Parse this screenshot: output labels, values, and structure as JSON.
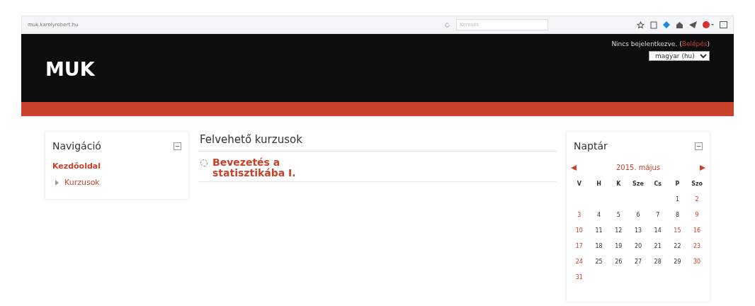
{
  "browser": {
    "url": "muk.karolyrobert.hu",
    "search": {
      "placeholder": "Keresés"
    }
  },
  "header": {
    "site_name": "MUK",
    "login_status": "Nincs bejelentkezve.",
    "login_open": "(",
    "login_link": "Belépés",
    "login_close": ")",
    "language": "magyar (hu)"
  },
  "navigation": {
    "title": "Navigáció",
    "items": [
      {
        "label": "Kezdőoldal",
        "kind": "link"
      },
      {
        "label": "Kurzusok",
        "kind": "branch"
      }
    ]
  },
  "courses": {
    "title": "Felvehető kurzusok",
    "items": [
      "Bevezetés a statisztikába I."
    ]
  },
  "calendar": {
    "title": "Naptár",
    "month": "2015. május",
    "weekdays": [
      "V",
      "H",
      "K",
      "Sze",
      "Cs",
      "P",
      "Szo"
    ],
    "weeks": [
      {
        "days": [
          {
            "kind": "blank"
          },
          {
            "kind": "blank"
          },
          {
            "kind": "blank"
          },
          {
            "kind": "blank"
          },
          {
            "kind": "blank"
          },
          {
            "kind": "day",
            "day": "1",
            "highlighted": false
          },
          {
            "kind": "day",
            "day": "2",
            "highlighted": true
          }
        ]
      },
      {
        "days": [
          {
            "kind": "day",
            "day": "3",
            "highlighted": true
          },
          {
            "kind": "day",
            "day": "4",
            "highlighted": false
          },
          {
            "kind": "day",
            "day": "5",
            "highlighted": false
          },
          {
            "kind": "day",
            "day": "6",
            "highlighted": false
          },
          {
            "kind": "day",
            "day": "7",
            "highlighted": false
          },
          {
            "kind": "day",
            "day": "8",
            "highlighted": false
          },
          {
            "kind": "day",
            "day": "9",
            "highlighted": true
          }
        ]
      },
      {
        "days": [
          {
            "kind": "day",
            "day": "10",
            "highlighted": true
          },
          {
            "kind": "day",
            "day": "11",
            "highlighted": false
          },
          {
            "kind": "day",
            "day": "12",
            "highlighted": false
          },
          {
            "kind": "day",
            "day": "13",
            "highlighted": false
          },
          {
            "kind": "day",
            "day": "14",
            "highlighted": false
          },
          {
            "kind": "day",
            "day": "15",
            "highlighted": true
          },
          {
            "kind": "day",
            "day": "16",
            "highlighted": true
          }
        ]
      },
      {
        "days": [
          {
            "kind": "day",
            "day": "17",
            "highlighted": true
          },
          {
            "kind": "day",
            "day": "18",
            "highlighted": false
          },
          {
            "kind": "day",
            "day": "19",
            "highlighted": false
          },
          {
            "kind": "day",
            "day": "20",
            "highlighted": false
          },
          {
            "kind": "day",
            "day": "21",
            "highlighted": false
          },
          {
            "kind": "day",
            "day": "22",
            "highlighted": false
          },
          {
            "kind": "day",
            "day": "23",
            "highlighted": true
          }
        ]
      },
      {
        "days": [
          {
            "kind": "day",
            "day": "24",
            "highlighted": true
          },
          {
            "kind": "day",
            "day": "25",
            "highlighted": false
          },
          {
            "kind": "day",
            "day": "26",
            "highlighted": false
          },
          {
            "kind": "day",
            "day": "27",
            "highlighted": false
          },
          {
            "kind": "day",
            "day": "28",
            "highlighted": false
          },
          {
            "kind": "day",
            "day": "29",
            "highlighted": false
          },
          {
            "kind": "day",
            "day": "30",
            "highlighted": true
          }
        ]
      },
      {
        "days": [
          {
            "kind": "day",
            "day": "31",
            "highlighted": true
          }
        ]
      }
    ]
  }
}
